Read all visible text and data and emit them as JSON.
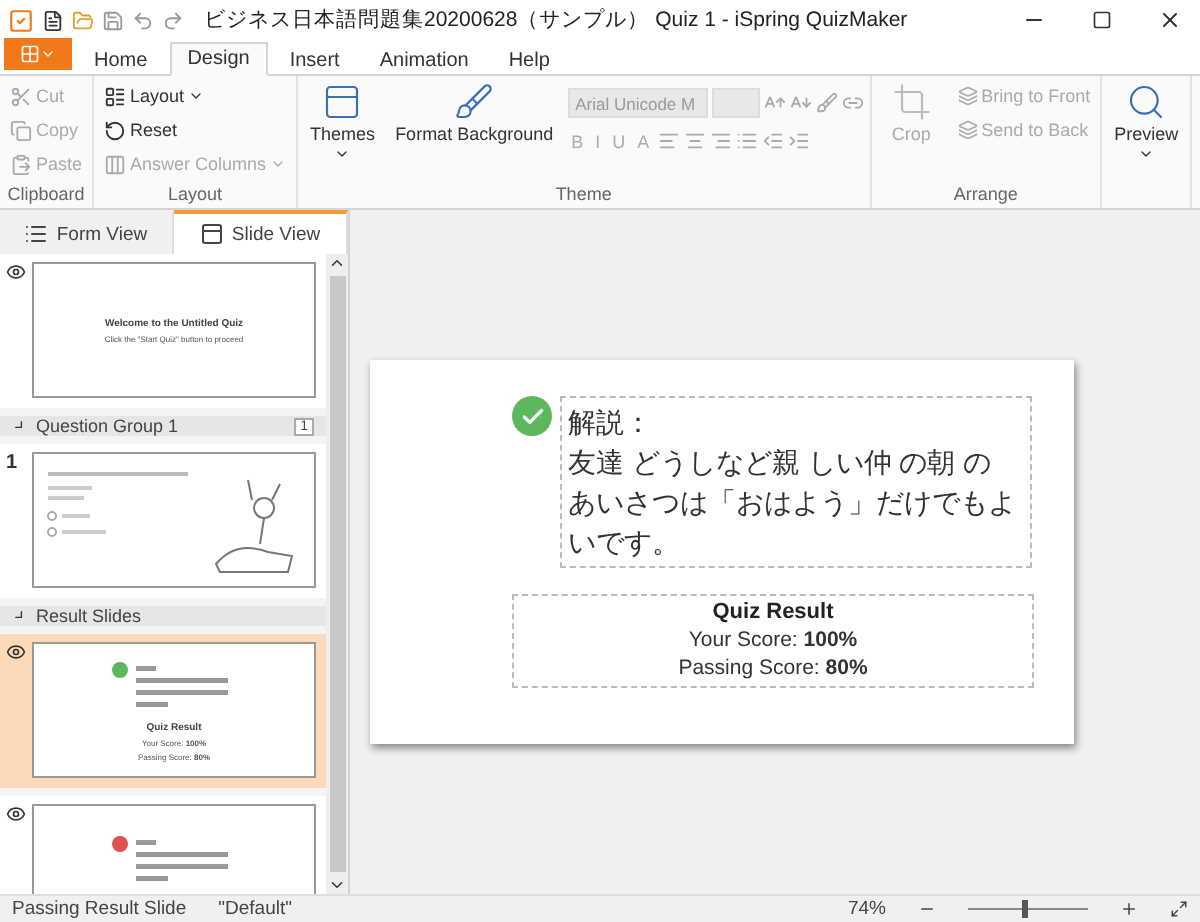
{
  "window": {
    "title": "ビジネス日本語問題集20200628（サンプル） Quiz 1 - iSpring QuizMaker"
  },
  "tabs": [
    {
      "label": "Home",
      "selected": false
    },
    {
      "label": "Design",
      "selected": true
    },
    {
      "label": "Insert",
      "selected": false
    },
    {
      "label": "Animation",
      "selected": false
    },
    {
      "label": "Help",
      "selected": false
    }
  ],
  "ribbon": {
    "groups": [
      {
        "label": "Clipboard",
        "items": [
          {
            "kind": "small",
            "label": "Cut",
            "disabled": true
          },
          {
            "kind": "small",
            "label": "Copy",
            "disabled": true
          },
          {
            "kind": "small",
            "label": "Paste",
            "disabled": true
          }
        ]
      },
      {
        "label": "Layout",
        "items": [
          {
            "kind": "small",
            "label": "Layout",
            "disabled": false,
            "dropdown": true
          },
          {
            "kind": "small",
            "label": "Reset",
            "disabled": false
          },
          {
            "kind": "small",
            "label": "Answer Columns",
            "disabled": true,
            "dropdown": true
          }
        ]
      },
      {
        "label": "Theme",
        "items": [
          {
            "kind": "large",
            "label": "Themes",
            "disabled": false,
            "dropdown": true
          },
          {
            "kind": "large",
            "label": "Format Background",
            "disabled": false
          },
          {
            "kind": "font",
            "font": "Arial Unicode M",
            "disabled": true,
            "format_buttons": [
              "B",
              "I",
              "U",
              "A"
            ]
          }
        ]
      },
      {
        "label": "Arrange",
        "items": [
          {
            "kind": "large",
            "label": "Crop",
            "disabled": true
          },
          {
            "kind": "stack",
            "disabled": true,
            "entries": [
              "Bring to Front",
              "Send to Back"
            ]
          }
        ]
      },
      {
        "items": [
          {
            "kind": "large",
            "label": "Preview",
            "disabled": false,
            "dropdown": true
          }
        ]
      }
    ]
  },
  "side_panel": {
    "view_tabs": [
      {
        "label": "Form View",
        "selected": false
      },
      {
        "label": "Slide View",
        "selected": true
      }
    ],
    "items": [
      {
        "kind": "slide",
        "selected": false,
        "thumbnail": {
          "kind": "welcome",
          "title": "Welcome to the Untitled Quiz",
          "subtitle": "Click the \"Start Quiz\" button to proceed"
        }
      },
      {
        "kind": "group",
        "label": "Question Group 1",
        "count": "1",
        "expanded": true
      },
      {
        "kind": "slide",
        "number": "1",
        "selected": false,
        "thumbnail": {
          "kind": "question"
        }
      },
      {
        "kind": "group",
        "label": "Result Slides",
        "expanded": true
      },
      {
        "kind": "slide",
        "selected": true,
        "thumbnail": {
          "kind": "result",
          "passed": true,
          "result_title": "Quiz Result",
          "lines": [
            "Your Score: **100%**",
            "Passing Score: **80%**"
          ]
        }
      },
      {
        "kind": "slide",
        "selected": false,
        "thumbnail": {
          "kind": "result",
          "passed": false
        }
      }
    ]
  },
  "slide": {
    "passed": true,
    "explanation": [
      "解説：",
      "友達 どうしなど親 しい仲 の朝 の",
      "あいさつは「おはよう」だけでもよ",
      "いです。"
    ],
    "result_title": "Quiz Result",
    "result_lines": [
      "Your Score: **100%**",
      "Passing Score: **80%**"
    ]
  },
  "status_bar": {
    "slide_name": "Passing Result Slide",
    "theme": "\"Default\"",
    "zoom": "74%",
    "zoom_slider": {
      "level": 0.45
    }
  }
}
